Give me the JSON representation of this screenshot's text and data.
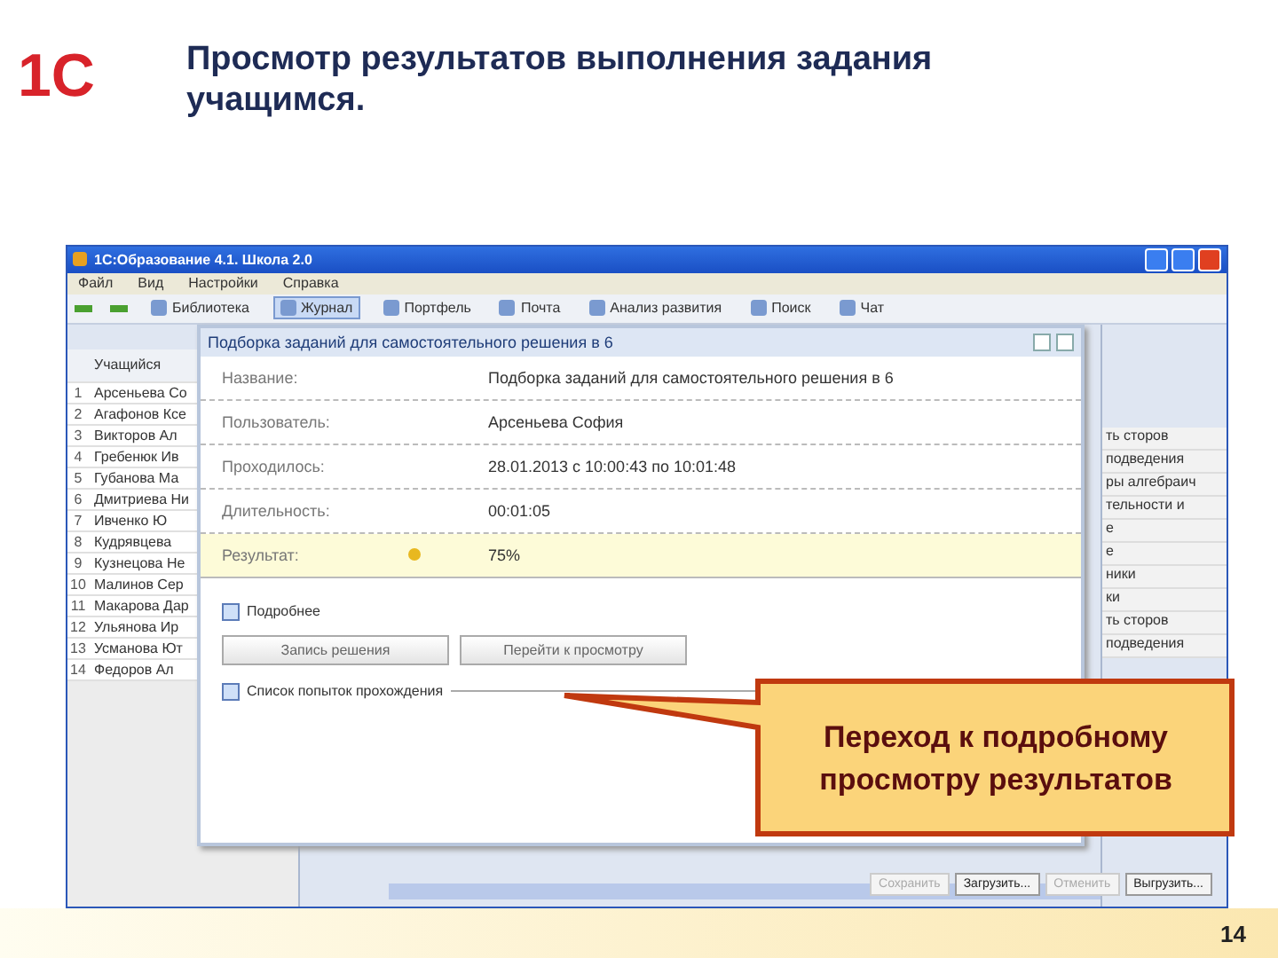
{
  "slide": {
    "logo": "1С",
    "title": "Просмотр результатов выполнения задания учащимся.",
    "page_number": "14"
  },
  "window": {
    "title": "1С:Образование 4.1. Школа 2.0"
  },
  "menu": [
    "Файл",
    "Вид",
    "Настройки",
    "Справка"
  ],
  "toolbar": [
    {
      "label": "Библиотека",
      "selected": false
    },
    {
      "label": "Журнал",
      "selected": true
    },
    {
      "label": "Портфель",
      "selected": false
    },
    {
      "label": "Почта",
      "selected": false
    },
    {
      "label": "Анализ развития",
      "selected": false
    },
    {
      "label": "Поиск",
      "selected": false
    },
    {
      "label": "Чат",
      "selected": false
    }
  ],
  "students": {
    "column": "Учащийся",
    "rows": [
      {
        "number": "1",
        "name": "Арсеньева Со"
      },
      {
        "number": "2",
        "name": "Агафонов Ксе"
      },
      {
        "number": "3",
        "name": "Викторов Ал"
      },
      {
        "number": "4",
        "name": "Гребенюк Ив"
      },
      {
        "number": "5",
        "name": "Губанова Ма"
      },
      {
        "number": "6",
        "name": "Дмитриева Ни"
      },
      {
        "number": "7",
        "name": "Ивченко Ю"
      },
      {
        "number": "8",
        "name": "Кудрявцева"
      },
      {
        "number": "9",
        "name": "Кузнецова Не"
      },
      {
        "number": "10",
        "name": "Малинов Сер"
      },
      {
        "number": "11",
        "name": "Макарова Дар"
      },
      {
        "number": "12",
        "name": "Ульянова Ир"
      },
      {
        "number": "13",
        "name": "Усманова Ют"
      },
      {
        "number": "14",
        "name": "Федоров Ал"
      }
    ]
  },
  "dialog": {
    "title": "Подборка заданий для самостоятельного решения в 6",
    "fields": [
      {
        "label": "Название:",
        "value": "Подборка заданий для самостоятельного решения в 6",
        "highlighted": false
      },
      {
        "label": "Пользователь:",
        "value": "Арсеньева София",
        "highlighted": false
      },
      {
        "label": "Проходилось:",
        "value": "28.01.2013 с 10:00:43 по 10:01:48",
        "highlighted": false
      },
      {
        "label": "Длительность:",
        "value": "00:01:05",
        "highlighted": false
      },
      {
        "label": "Результат:",
        "value": "75%",
        "highlighted": true
      }
    ],
    "details_toggle": {
      "label": "Подробнее",
      "expanded": true
    },
    "buttons": [
      "Запись решения",
      "Перейти к просмотру"
    ],
    "attempts_toggle": {
      "label": "Список попыток прохождения",
      "expanded": true
    }
  },
  "right_panel": {
    "items": [
      "ть сторов",
      "подведения",
      "ры алгебраич",
      "тельности и",
      "е",
      "е",
      "ники",
      "ки",
      "ть сторов",
      "подведения"
    ],
    "buttons": [
      {
        "label": "Сохранить",
        "disabled": true
      },
      {
        "label": "Загрузить...",
        "disabled": false
      },
      {
        "label": "Отменить",
        "disabled": true
      },
      {
        "label": "Выгрузить...",
        "disabled": false
      }
    ]
  },
  "callout": {
    "text": "Переход к подробному просмотру результатов"
  }
}
